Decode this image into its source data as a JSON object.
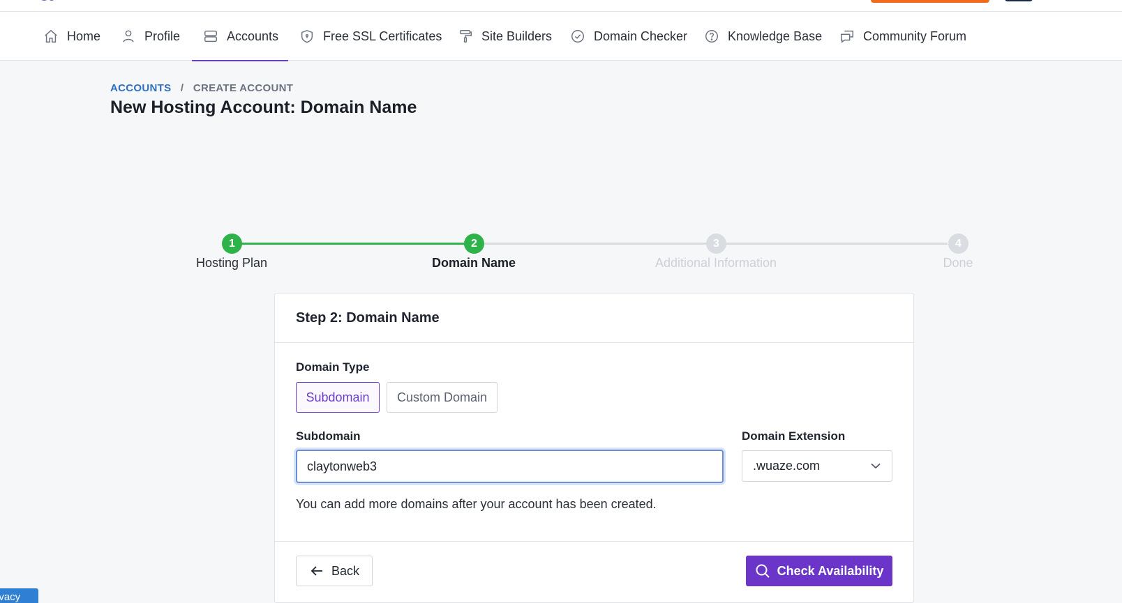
{
  "nav": {
    "items": [
      {
        "label": "Home",
        "icon": "home-icon"
      },
      {
        "label": "Profile",
        "icon": "user-icon"
      },
      {
        "label": "Accounts",
        "icon": "server-icon"
      },
      {
        "label": "Free SSL Certificates",
        "icon": "shield-icon"
      },
      {
        "label": "Site Builders",
        "icon": "paint-roller-icon"
      },
      {
        "label": "Domain Checker",
        "icon": "check-circle-icon"
      },
      {
        "label": "Knowledge Base",
        "icon": "question-circle-icon"
      },
      {
        "label": "Community Forum",
        "icon": "chat-icon"
      }
    ],
    "active": "Accounts"
  },
  "breadcrumb": {
    "first": "ACCOUNTS",
    "separator": "/",
    "second": "CREATE ACCOUNT"
  },
  "page_title": "New Hosting Account: Domain Name",
  "stepper": {
    "steps": [
      {
        "number": "1",
        "label": "Hosting Plan",
        "state": "completed"
      },
      {
        "number": "2",
        "label": "Domain Name",
        "state": "current"
      },
      {
        "number": "3",
        "label": "Additional Information",
        "state": "pending"
      },
      {
        "number": "4",
        "label": "Done",
        "state": "pending"
      }
    ]
  },
  "card": {
    "title": "Step 2: Domain Name",
    "domain_type_label": "Domain Type",
    "domain_type_options": [
      "Subdomain",
      "Custom Domain"
    ],
    "domain_type_selected": "Subdomain",
    "subdomain_label": "Subdomain",
    "subdomain_value": "claytonweb3",
    "extension_label": "Domain Extension",
    "extension_value": ".wuaze.com",
    "help_text": "You can add more domains after your account has been created.",
    "back_label": "Back",
    "check_label": "Check Availability"
  },
  "privacy_label": "Privacy",
  "colors": {
    "accent": "#6a35c8",
    "step_complete": "#2eb24a",
    "step_pending": "#d9dce1",
    "link_blue": "#2f6fc0"
  }
}
